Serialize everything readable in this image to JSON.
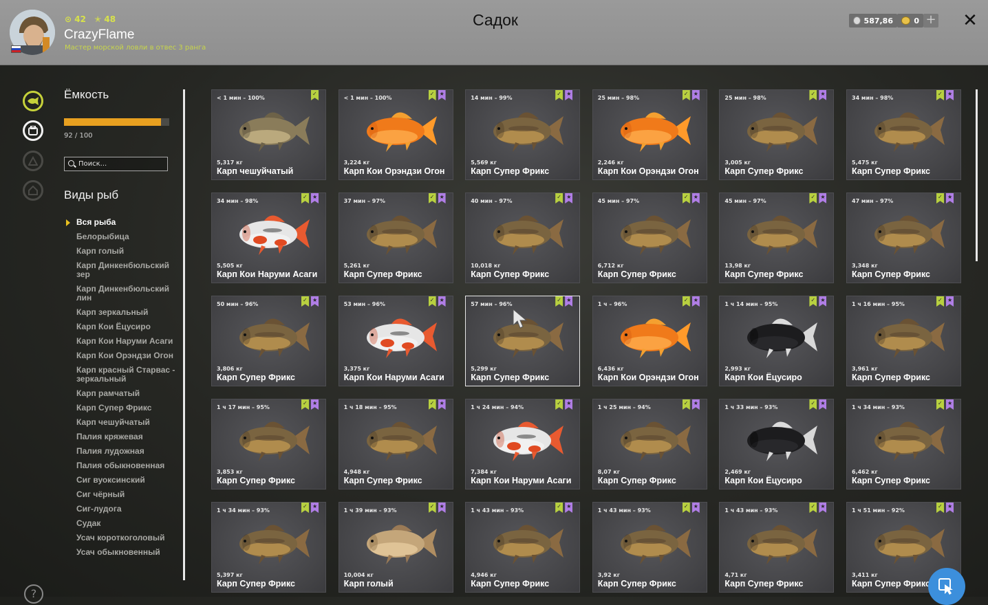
{
  "header": {
    "title": "Садок",
    "player": {
      "name": "CrazyFlame",
      "level_a": "42",
      "level_b": "48",
      "rank": "Мастер морской ловли в отвес 3 ранга"
    },
    "currency": {
      "silver": "587,86",
      "gold": "0",
      "add_label": "+"
    },
    "close_label": "✕"
  },
  "sidebar": {
    "capacity_title": "Ёмкость",
    "capacity_text": "92 / 100",
    "capacity_fraction": 0.92,
    "search_placeholder": "Поиск...",
    "types_title": "Виды рыб",
    "fish_types": [
      "Вся рыба",
      "Белорыбица",
      "Карп голый",
      "Карп Динкенбюльский зер",
      "Карп Динкенбюльский лин",
      "Карп зеркальный",
      "Карп Кои Ёцусиро",
      "Карп Кои Наруми Асаги",
      "Карп Кои Орэндзи Огон",
      "Карп красный Старвас - зеркальный",
      "Карп рамчатый",
      "Карп Супер Фрикс",
      "Карп чешуйчатый",
      "Палия кряжевая",
      "Палия лудожная",
      "Палия обыкновенная",
      "Сиг вуоксинский",
      "Сиг чёрный",
      "Сиг-лудога",
      "Судак",
      "Усач короткоголовый",
      "Усач обыкновенный"
    ],
    "selected_type": "Вся рыба"
  },
  "colors": {
    "accent_yellow": "#c6d13a",
    "capacity_fill": "#e8a020",
    "badge_green": "#b8d040",
    "badge_purple": "#b07ee6",
    "fab_blue": "#3c8fdc"
  },
  "fish_cards": [
    {
      "time": "< 1 мин – 100%",
      "weight": "5,317 кг",
      "name": "Карп чешуйчатый",
      "variant": "common"
    },
    {
      "time": "< 1 мин – 100%",
      "weight": "3,224 кг",
      "name": "Карп Кои Орэндзи Огон",
      "variant": "orange"
    },
    {
      "time": "14 мин – 99%",
      "weight": "5,569 кг",
      "name": "Карп Супер Фрикс",
      "variant": "mirror"
    },
    {
      "time": "25 мин – 98%",
      "weight": "2,246 кг",
      "name": "Карп Кои Орэндзи Огон",
      "variant": "orange"
    },
    {
      "time": "25 мин – 98%",
      "weight": "3,005 кг",
      "name": "Карп Супер Фрикс",
      "variant": "mirror"
    },
    {
      "time": "34 мин – 98%",
      "weight": "5,475 кг",
      "name": "Карп Супер Фрикс",
      "variant": "mirror"
    },
    {
      "time": "34 мин – 98%",
      "weight": "5,505 кг",
      "name": "Карп Кои Наруми Асаги",
      "variant": "koi"
    },
    {
      "time": "37 мин – 97%",
      "weight": "5,261 кг",
      "name": "Карп Супер Фрикс",
      "variant": "mirror"
    },
    {
      "time": "40 мин – 97%",
      "weight": "10,018 кг",
      "name": "Карп Супер Фрикс",
      "variant": "mirror"
    },
    {
      "time": "45 мин – 97%",
      "weight": "6,712 кг",
      "name": "Карп Супер Фрикс",
      "variant": "mirror"
    },
    {
      "time": "45 мин – 97%",
      "weight": "13,98 кг",
      "name": "Карп Супер Фрикс",
      "variant": "mirror"
    },
    {
      "time": "47 мин – 97%",
      "weight": "3,348 кг",
      "name": "Карп Супер Фрикс",
      "variant": "mirror"
    },
    {
      "time": "50 мин – 96%",
      "weight": "3,806 кг",
      "name": "Карп Супер Фрикс",
      "variant": "mirror"
    },
    {
      "time": "53 мин – 96%",
      "weight": "3,375 кг",
      "name": "Карп Кои Наруми Асаги",
      "variant": "koi"
    },
    {
      "time": "57 мин – 96%",
      "weight": "5,299 кг",
      "name": "Карп Супер Фрикс",
      "variant": "mirror",
      "selected": true
    },
    {
      "time": "1 ч – 96%",
      "weight": "6,436 кг",
      "name": "Карп Кои Орэндзи Огон",
      "variant": "orange"
    },
    {
      "time": "1 ч 14 мин – 95%",
      "weight": "2,993 кг",
      "name": "Карп Кои Ёцусиро",
      "variant": "black"
    },
    {
      "time": "1 ч 16 мин – 95%",
      "weight": "3,961 кг",
      "name": "Карп Супер Фрикс",
      "variant": "mirror"
    },
    {
      "time": "1 ч 17 мин – 95%",
      "weight": "3,853 кг",
      "name": "Карп Супер Фрикс",
      "variant": "mirror"
    },
    {
      "time": "1 ч 18 мин – 95%",
      "weight": "4,948 кг",
      "name": "Карп Супер Фрикс",
      "variant": "mirror"
    },
    {
      "time": "1 ч 24 мин – 94%",
      "weight": "7,384 кг",
      "name": "Карп Кои Наруми Асаги",
      "variant": "koi"
    },
    {
      "time": "1 ч 25 мин – 94%",
      "weight": "8,07 кг",
      "name": "Карп Супер Фрикс",
      "variant": "mirror"
    },
    {
      "time": "1 ч 33 мин – 93%",
      "weight": "2,469 кг",
      "name": "Карп Кои Ёцусиро",
      "variant": "black"
    },
    {
      "time": "1 ч 34 мин – 93%",
      "weight": "6,462 кг",
      "name": "Карп Супер Фрикс",
      "variant": "mirror"
    },
    {
      "time": "1 ч 34 мин – 93%",
      "weight": "5,397 кг",
      "name": "Карп Супер Фрикс",
      "variant": "mirror"
    },
    {
      "time": "1 ч 39 мин – 93%",
      "weight": "10,004 кг",
      "name": "Карп голый",
      "variant": "leather"
    },
    {
      "time": "1 ч 43 мин – 93%",
      "weight": "4,946 кг",
      "name": "Карп Супер Фрикс",
      "variant": "mirror"
    },
    {
      "time": "1 ч 43 мин – 93%",
      "weight": "3,92 кг",
      "name": "Карп Супер Фрикс",
      "variant": "mirror"
    },
    {
      "time": "1 ч 43 мин – 93%",
      "weight": "4,71 кг",
      "name": "Карп Супер Фрикс",
      "variant": "mirror"
    },
    {
      "time": "1 ч 51 мин – 92%",
      "weight": "3,411 кг",
      "name": "Карп Супер Фрикс",
      "variant": "mirror"
    }
  ]
}
